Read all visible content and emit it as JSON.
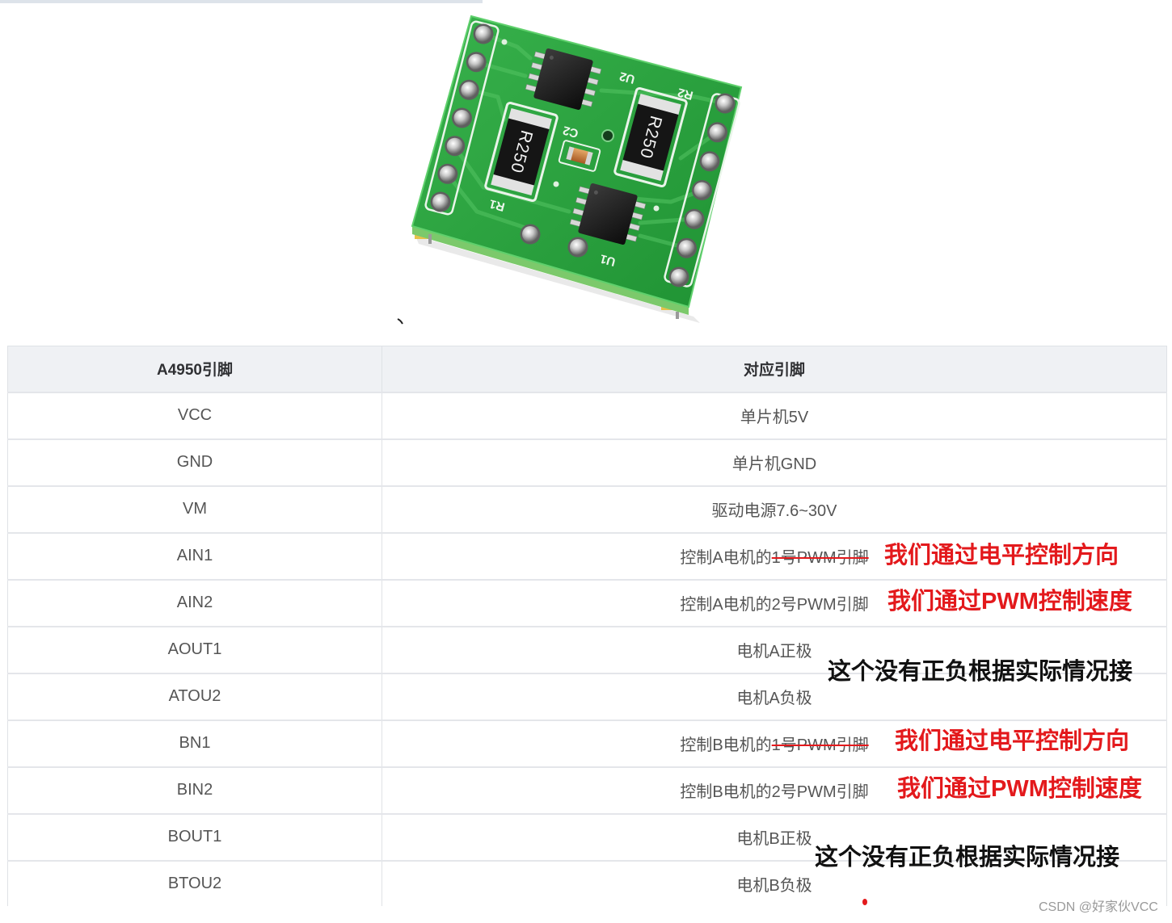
{
  "colors": {
    "header_bg": "#eff1f4",
    "note_red": "#e3191c",
    "note_black": "#111111",
    "cell_text": "#555555",
    "watermark": "#9a9a9a",
    "board_green": "#2aa03c"
  },
  "photo": {
    "silkscreen": {
      "u2": "U2",
      "r2": "R2",
      "c2": "C2",
      "r1": "R1",
      "u1": "U1"
    },
    "resistor_marking": {
      "r1": "R250",
      "r2": "R250"
    }
  },
  "table": {
    "headers": [
      "A4950引脚",
      "对应引脚"
    ],
    "rows": [
      {
        "pin": "VCC",
        "mapping": "单片机5V"
      },
      {
        "pin": "GND",
        "mapping": "单片机GND"
      },
      {
        "pin": "VM",
        "mapping": "驱动电源7.6~30V"
      },
      {
        "pin": "AIN1",
        "mapping": "控制A电机的",
        "mapping_struck": "1号PWM引脚"
      },
      {
        "pin": "AIN2",
        "mapping": "控制A电机的2号PWM引脚"
      },
      {
        "pin": "AOUT1",
        "mapping": "电机A正极"
      },
      {
        "pin": "ATOU2",
        "mapping": "电机A负极"
      },
      {
        "pin": "BN1",
        "mapping": "控制B电机的",
        "mapping_struck": "1号PWM引脚"
      },
      {
        "pin": "BIN2",
        "mapping": "控制B电机的2号PWM引脚"
      },
      {
        "pin": "BOUT1",
        "mapping": "电机B正极"
      },
      {
        "pin": "BTOU2",
        "mapping": "电机B负极"
      }
    ]
  },
  "annotations": {
    "ain1_note": "我们通过电平控制方向",
    "ain2_note": "我们通过PWM控制速度",
    "motor_a_note": "这个没有正负根据实际情况接",
    "bn1_note": "我们通过电平控制方向",
    "bin2_note": "我们通过PWM控制速度",
    "motor_b_note": "这个没有正负根据实际情况接"
  },
  "watermark": "CSDN @好家伙VCC"
}
